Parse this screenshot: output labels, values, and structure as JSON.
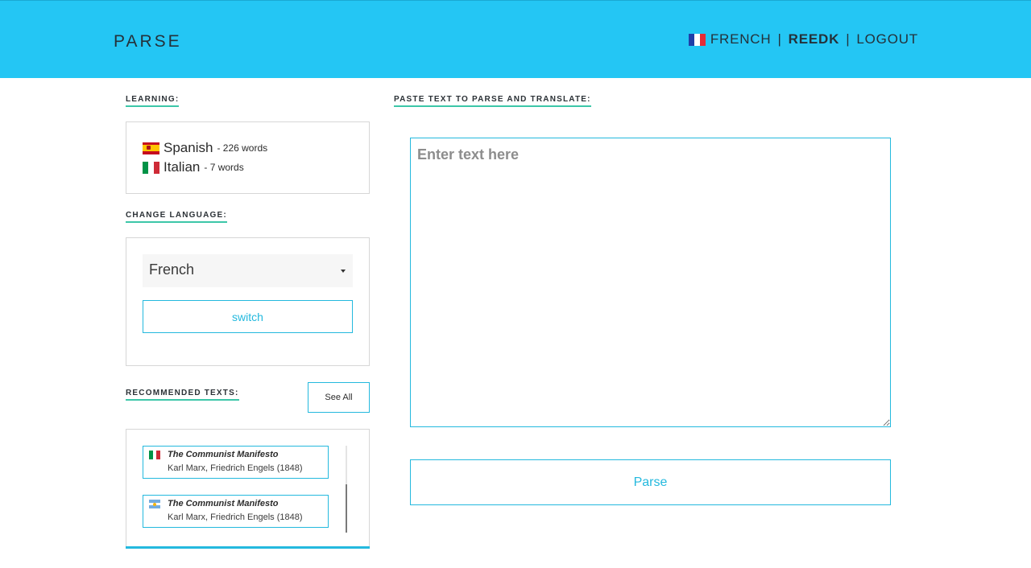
{
  "header": {
    "logo": "PARSE",
    "language": "FRENCH",
    "separator": "|",
    "username": "REEDK",
    "logout": "LOGOUT"
  },
  "learning": {
    "title": "LEARNING:",
    "languages": [
      {
        "name": "Spanish",
        "count": "- 226 words",
        "flag": "spain-flag-icon"
      },
      {
        "name": "Italian",
        "count": "- 7 words",
        "flag": "italy-flag-icon"
      }
    ]
  },
  "change_language": {
    "title": "CHANGE LANGUAGE:",
    "selected": "French",
    "switch_label": "switch"
  },
  "recommended": {
    "title": "RECOMMENDED TEXTS:",
    "see_all": "See All",
    "texts": [
      {
        "title": "The Communist Manifesto",
        "author": "Karl Marx, Friedrich Engels (1848)",
        "flag": "italy-flag-icon"
      },
      {
        "title": "The Communist Manifesto",
        "author": "Karl Marx, Friedrich Engels (1848)",
        "flag": "argentina-flag-icon"
      }
    ]
  },
  "paste": {
    "title": "PASTE TEXT TO PARSE AND TRANSLATE:",
    "placeholder": "Enter text here",
    "value": "",
    "button": "Parse"
  },
  "colors": {
    "header_bg": "#24c6f4",
    "accent": "#24b9de",
    "underline": "#3cc6a8"
  }
}
